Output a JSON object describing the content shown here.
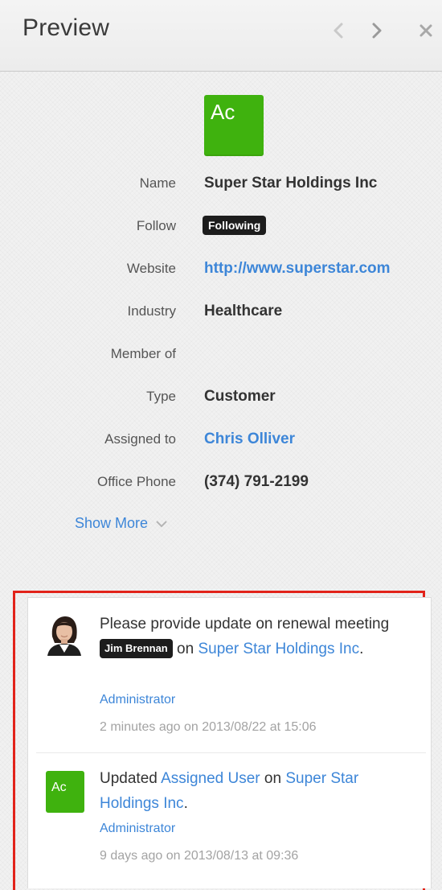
{
  "header": {
    "title": "Preview",
    "prev_icon": "chevron-left-icon",
    "next_icon": "chevron-right-icon",
    "close_icon": "close-icon"
  },
  "record": {
    "logo_text": "Ac",
    "logo_color": "#3fb20e",
    "fields": {
      "name": {
        "label": "Name",
        "value": "Super Star Holdings Inc"
      },
      "follow": {
        "label": "Follow",
        "value": "Following"
      },
      "website": {
        "label": "Website",
        "value": "http://www.superstar.com"
      },
      "industry": {
        "label": "Industry",
        "value": "Healthcare"
      },
      "member_of": {
        "label": "Member of",
        "value": ""
      },
      "type": {
        "label": "Type",
        "value": "Customer"
      },
      "assigned_to": {
        "label": "Assigned to",
        "value": "Chris Olliver"
      },
      "office_phone": {
        "label": "Office Phone",
        "value": "(374) 791-2199"
      }
    },
    "show_more": "Show More"
  },
  "activity": {
    "highlight_color": "#e2231a",
    "items": [
      {
        "avatar": "person-avatar",
        "text_before": "Please provide update on renewal meeting",
        "mention": "Jim Brennan",
        "text_middle": "on",
        "link": "Super Star Holdings Inc",
        "text_after": ".",
        "role": "Administrator",
        "time": "2 minutes ago on 2013/08/22 at 15:06"
      },
      {
        "avatar_text": "Ac",
        "text_before": "Updated",
        "field_link": "Assigned User",
        "text_middle": "on",
        "link": "Super Star Holdings Inc",
        "text_after": ".",
        "role": "Administrator",
        "time": "9 days ago on 2013/08/13 at 09:36"
      }
    ]
  }
}
